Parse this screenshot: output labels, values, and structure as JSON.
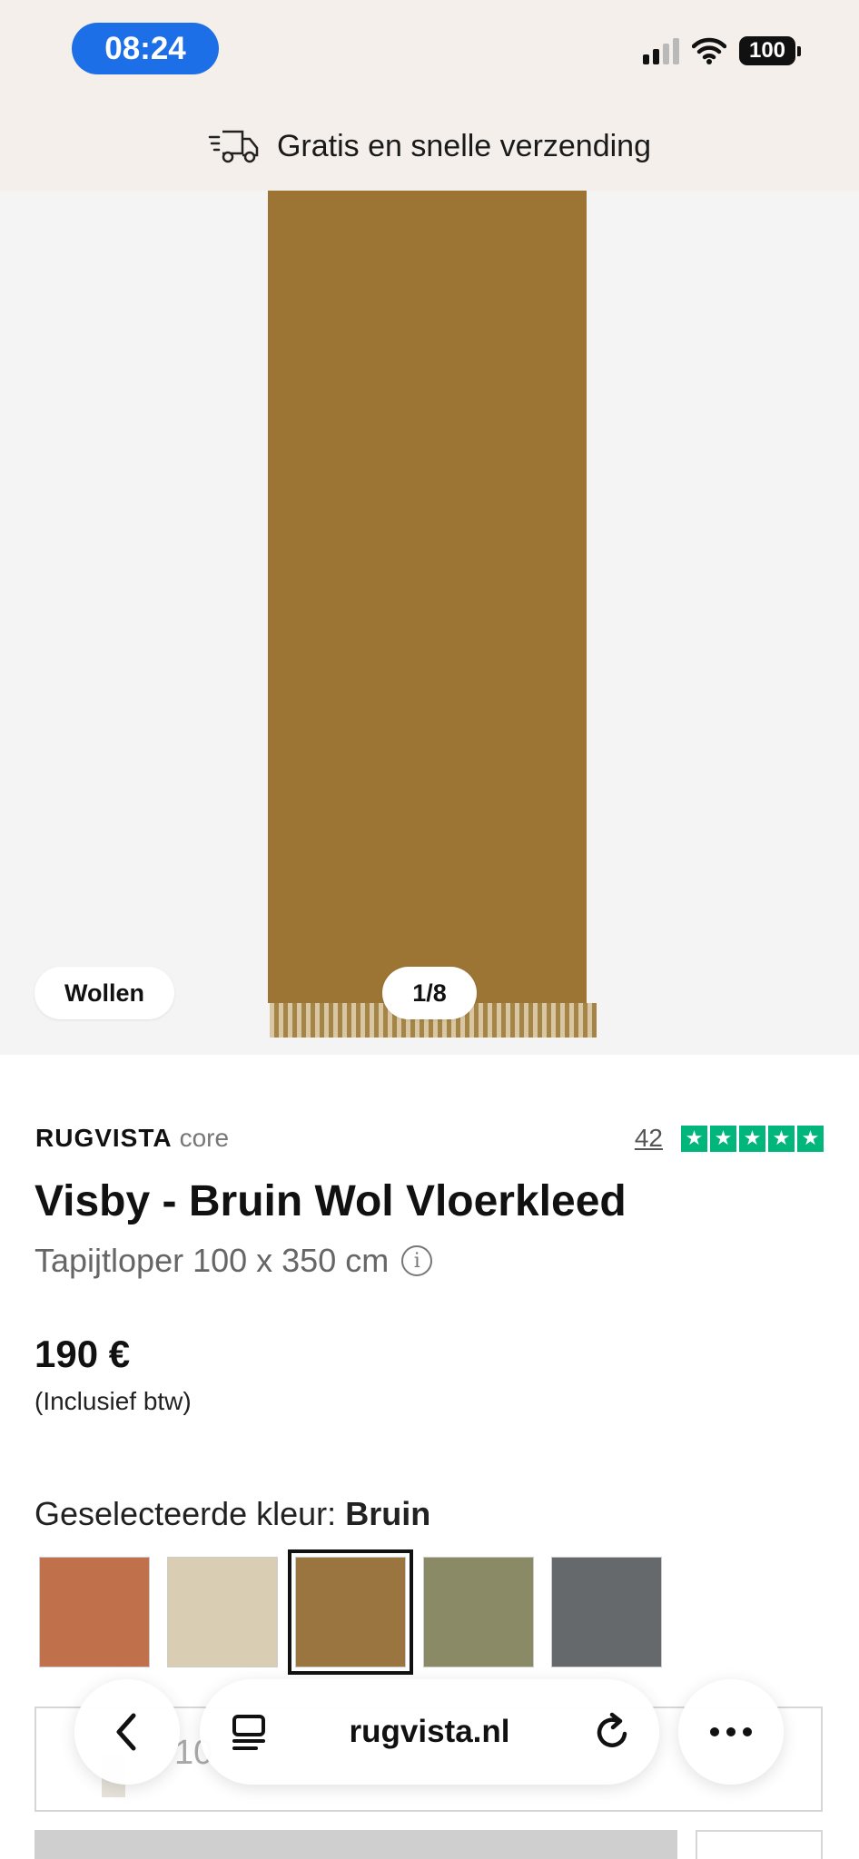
{
  "status_bar": {
    "time": "08:24",
    "battery": "100"
  },
  "banner": {
    "text": "Gratis en snelle verzending",
    "icon": "truck-icon"
  },
  "gallery": {
    "material_badge": "Wollen",
    "counter": "1/8",
    "rug_color": "#9c7434"
  },
  "product": {
    "brand": "RUGVISTA",
    "brand_sub": "core",
    "review_count": "42",
    "rating_stars": 5,
    "title": "Visby - Bruin Wol Vloerkleed",
    "subtitle": "Tapijtloper 100 x 350 cm",
    "price": "190 €",
    "vat_note": "(Inclusief btw)"
  },
  "color_selector": {
    "label": "Geselecteerde kleur:",
    "selected": "Bruin",
    "swatches": [
      {
        "color": "#c0704a",
        "selected": false
      },
      {
        "color": "#d9cdb4",
        "selected": false
      },
      {
        "color": "#9a7540",
        "selected": true
      },
      {
        "color": "#8a8a66",
        "selected": false
      },
      {
        "color": "#66696b",
        "selected": false
      }
    ]
  },
  "size_selector": {
    "partial_text": "10"
  },
  "browser_toolbar": {
    "url": "rugvista.nl"
  },
  "colors": {
    "accent_time_pill": "#1d6fe8",
    "trustpilot_green": "#00b67a",
    "banner_bg": "#f4efea"
  }
}
